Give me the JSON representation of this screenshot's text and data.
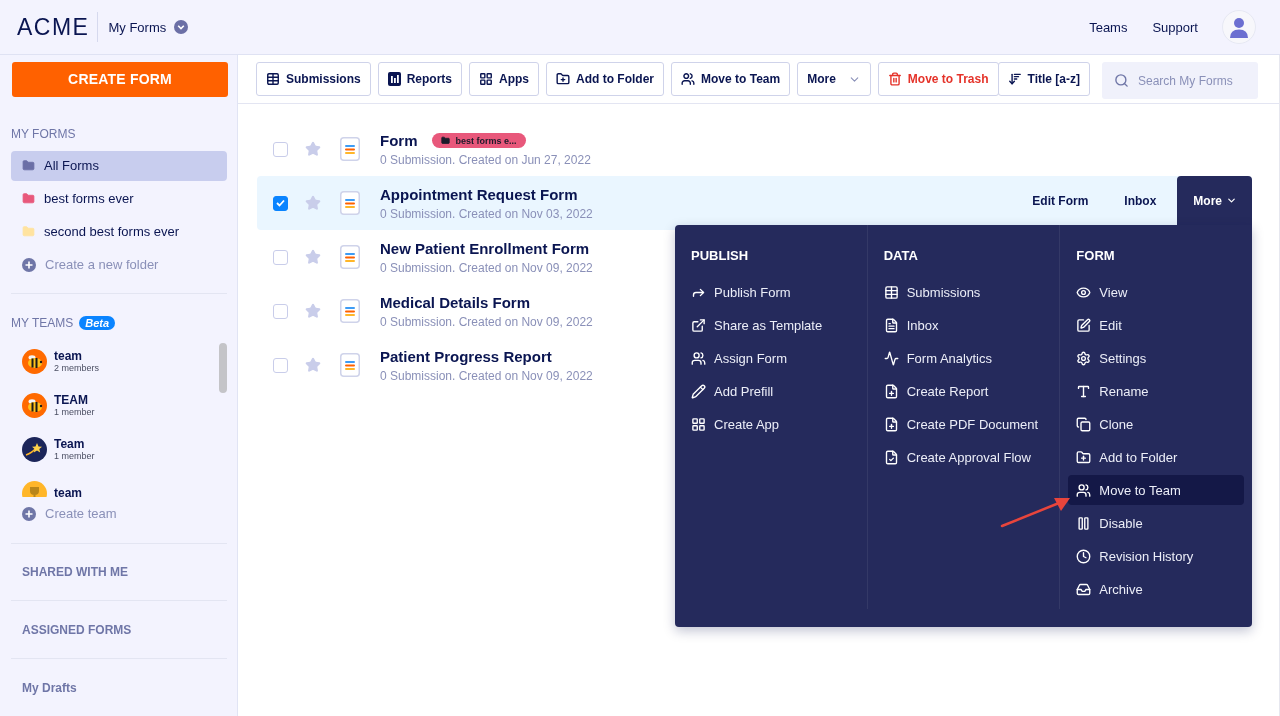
{
  "header": {
    "logo": "ACME",
    "title": "My Forms",
    "nav": [
      "Teams",
      "Support"
    ]
  },
  "sidebar": {
    "create_button": "CREATE FORM",
    "my_forms": {
      "heading": "MY FORMS",
      "folders": [
        {
          "label": "All Forms",
          "color": "#6b6fa6",
          "selected": true
        },
        {
          "label": "best forms ever",
          "color": "#e8587b",
          "selected": false
        },
        {
          "label": "second best forms ever",
          "color": "#ffe3a0",
          "selected": false
        }
      ],
      "create": "Create a new folder"
    },
    "my_teams": {
      "heading": "MY TEAMS",
      "badge": "Beta",
      "teams": [
        {
          "name": "team",
          "members": "2 members",
          "kind": "bee"
        },
        {
          "name": "TEAM",
          "members": "1 member",
          "kind": "bee"
        },
        {
          "name": "Team",
          "members": "1 member",
          "kind": "star"
        },
        {
          "name": "team",
          "kind": "trophy"
        }
      ],
      "create": "Create team"
    },
    "sections": [
      "SHARED WITH ME",
      "ASSIGNED FORMS",
      "My Drafts"
    ]
  },
  "toolbar": {
    "buttons": [
      {
        "label": "Submissions",
        "kind": "plain"
      },
      {
        "label": "Reports",
        "kind": "plain"
      },
      {
        "label": "Apps",
        "kind": "plain"
      },
      {
        "label": "Add to Folder",
        "kind": "plain"
      },
      {
        "label": "Move to Team",
        "kind": "plain"
      },
      {
        "label": "More",
        "kind": "dropdown"
      },
      {
        "label": "Move to Trash",
        "kind": "danger"
      },
      {
        "label": "Title [a-z]",
        "kind": "sort"
      }
    ],
    "search": {
      "placeholder": "Search My Forms"
    }
  },
  "forms": [
    {
      "title": "Form",
      "tag": {
        "label": "best forms e...",
        "color": "#e8587b"
      },
      "meta": "0 Submission. Created on Jun 27, 2022",
      "checked": false,
      "starred": false
    },
    {
      "title": "Appointment Request Form",
      "meta": "0 Submission. Created on Nov 03, 2022",
      "checked": true,
      "starred": false,
      "actions": [
        "Edit Form",
        "Inbox"
      ],
      "more": {
        "label": "More",
        "expanded": true
      },
      "menu": {
        "columns": [
          {
            "heading": "PUBLISH",
            "items": [
              {
                "label": "Publish Form",
                "selected": false
              },
              {
                "label": "Share as Template",
                "selected": false
              },
              {
                "label": "Assign Form",
                "selected": false
              },
              {
                "label": "Add Prefill",
                "selected": false
              },
              {
                "label": "Create App",
                "selected": false
              }
            ]
          },
          {
            "heading": "DATA",
            "items": [
              {
                "label": "Submissions",
                "selected": false
              },
              {
                "label": "Inbox",
                "selected": false
              },
              {
                "label": "Form Analytics",
                "selected": false
              },
              {
                "label": "Create Report",
                "selected": false
              },
              {
                "label": "Create PDF Document",
                "selected": false
              },
              {
                "label": "Create Approval Flow",
                "selected": false
              }
            ]
          },
          {
            "heading": "FORM",
            "items": [
              {
                "label": "View",
                "selected": false
              },
              {
                "label": "Edit",
                "selected": false
              },
              {
                "label": "Settings",
                "selected": false
              },
              {
                "label": "Rename",
                "selected": false
              },
              {
                "label": "Clone",
                "selected": false
              },
              {
                "label": "Add to Folder",
                "selected": false
              },
              {
                "label": "Move to Team",
                "selected": true
              },
              {
                "label": "Disable",
                "selected": false
              },
              {
                "label": "Revision History",
                "selected": false
              },
              {
                "label": "Archive",
                "selected": false
              }
            ]
          }
        ]
      }
    },
    {
      "title": "New Patient Enrollment Form",
      "meta": "0 Submission. Created on Nov 09, 2022",
      "checked": false,
      "starred": false
    },
    {
      "title": "Medical Details Form",
      "meta": "0 Submission. Created on Nov 09, 2022",
      "checked": false,
      "starred": false
    },
    {
      "title": "Patient Progress Report",
      "meta": "0 Submission. Created on Nov 09, 2022",
      "checked": false,
      "starred": false
    }
  ]
}
